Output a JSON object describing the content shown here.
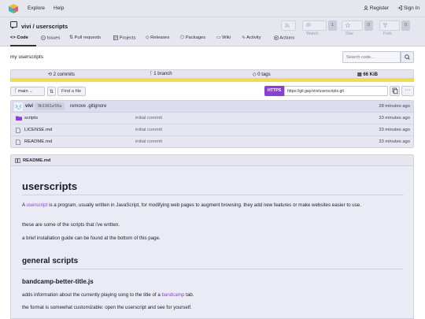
{
  "topnav": {
    "explore": "Explore",
    "help": "Help",
    "register": "Register",
    "signin": "Sign In"
  },
  "repo": {
    "title": "vivi / userscripts",
    "watch_label": "Watch",
    "watch_count": "1",
    "star_label": "Star",
    "star_count": "0",
    "fork_label": "Fork",
    "fork_count": "0"
  },
  "tabs": [
    {
      "label": "Code"
    },
    {
      "label": "Issues"
    },
    {
      "label": "Pull requests"
    },
    {
      "label": "Projects"
    },
    {
      "label": "Releases"
    },
    {
      "label": "Packages"
    },
    {
      "label": "Wiki"
    },
    {
      "label": "Activity"
    },
    {
      "label": "Actions"
    }
  ],
  "description": "my userscripts",
  "search": {
    "placeholder": "Search code..."
  },
  "stats": {
    "commits": "2 commits",
    "branches": "1 branch",
    "tags": "0 tags",
    "size": "66 KiB"
  },
  "branch": {
    "name": "main",
    "find_file": "Find a file"
  },
  "clone": {
    "protocol": "HTTPS",
    "url": "https://git.gay/vivi/userscripts.git"
  },
  "last_commit": {
    "author": "vivi",
    "sha": "9b1981e56a",
    "message": "remove .gitignore",
    "time": "28 minutes ago"
  },
  "files": [
    {
      "name": "scripts",
      "type": "folder",
      "commit": "initial commit",
      "time": "33 minutes ago"
    },
    {
      "name": "LICENSE.md",
      "type": "file",
      "commit": "initial commit",
      "time": "33 minutes ago"
    },
    {
      "name": "README.md",
      "type": "file",
      "commit": "initial commit",
      "time": "33 minutes ago"
    }
  ],
  "readme": {
    "header": "README.md",
    "h1": "userscripts",
    "p1_prefix": "A ",
    "p1_link": "userscript",
    "p1_suffix": " is a program, usually written in JavaScript, for modifying web pages to augment browsing. they add new features or make websites easier to use.",
    "p2": "these are some of the scripts that i've written.",
    "p3": "a brief installation guide can be found at the bottom of this page.",
    "h2": "general scripts",
    "h3": "bandcamp-better-title.js",
    "p4_prefix": "adds information about the currently playing song to the title of a ",
    "p4_link": "bandcamp",
    "p4_suffix": " tab.",
    "p5": "the format is somewhat customizable: open the userscript and see for yourself."
  },
  "colors": {
    "accent": "#8a3fd6",
    "langbar": "#f0dc4e",
    "folder": "#8a3fd6"
  }
}
